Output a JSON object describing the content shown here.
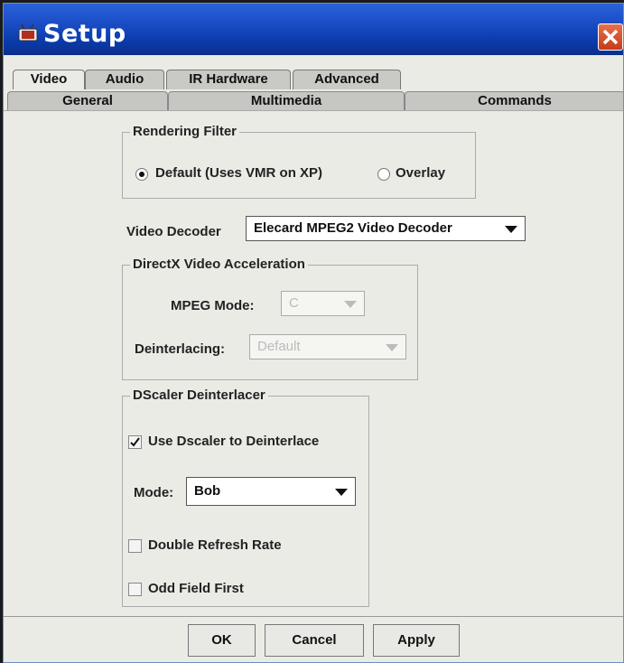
{
  "window": {
    "title": "Setup"
  },
  "tabs_top": [
    {
      "label": "Video",
      "active": true
    },
    {
      "label": "Audio",
      "active": false
    },
    {
      "label": "IR Hardware",
      "active": false
    },
    {
      "label": "Advanced",
      "active": false
    }
  ],
  "tabs_sub": [
    {
      "label": "General",
      "active": false
    },
    {
      "label": "Multimedia",
      "active": false
    },
    {
      "label": "Commands",
      "active": false
    }
  ],
  "rendering_filter": {
    "legend": "Rendering Filter",
    "option_default": "Default (Uses VMR on XP)",
    "option_overlay": "Overlay",
    "selected": "default"
  },
  "video_decoder": {
    "label": "Video Decoder",
    "value": "Elecard MPEG2 Video Decoder"
  },
  "directx": {
    "legend": "DirectX Video Acceleration",
    "mpeg_mode_label": "MPEG Mode:",
    "mpeg_mode_value": "C",
    "deinterlacing_label": "Deinterlacing:",
    "deinterlacing_value": "Default"
  },
  "dscaler": {
    "legend": "DScaler Deinterlacer",
    "use_label": "Use Dscaler to Deinterlace",
    "use_checked": true,
    "mode_label": "Mode:",
    "mode_value": "Bob",
    "double_refresh_label": "Double Refresh Rate",
    "double_refresh_checked": false,
    "odd_field_label": "Odd Field First",
    "odd_field_checked": false
  },
  "buttons": {
    "ok": "OK",
    "cancel": "Cancel",
    "apply": "Apply"
  },
  "colors": {
    "titlebar": "#0a3aa9",
    "close": "#d9532a",
    "panel": "#ebebe6"
  }
}
